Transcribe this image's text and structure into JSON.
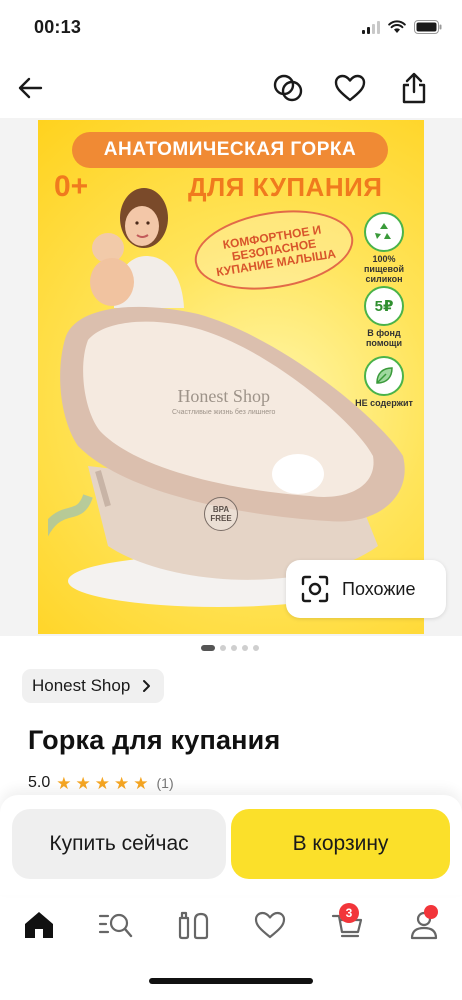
{
  "status_bar": {
    "time": "00:13"
  },
  "product_image": {
    "promo_title": "АНАТОМИЧЕСКАЯ ГОРКА",
    "promo_age": "0+",
    "promo_subtitle": "ДЛЯ КУПАНИЯ",
    "promo_oval_text": "КОМФОРТНОЕ И БЕЗОПАСНОЕ КУПАНИЕ МАЛЫША",
    "badge_silicone": "100% пищевой силикон",
    "badge_donation_value": "5₽",
    "badge_donation": "В фонд помощи",
    "badge_nontoxic": "НЕ содержит",
    "watermark_name": "Honest Shop",
    "watermark_tagline": "Счастливые жизнь без лишнего",
    "bpa_label": "BPA FREE",
    "similar_label": "Похожие",
    "pager_count": 5,
    "pager_active": 1
  },
  "shop": {
    "name": "Honest Shop"
  },
  "product": {
    "title": "Горка для купания",
    "rating": "5.0",
    "stars": 5,
    "reviews_count": "(1)"
  },
  "actions": {
    "buy_now_label": "Купить сейчас",
    "add_to_cart_label": "В корзину"
  },
  "tab_bar": {
    "items": [
      {
        "icon": "home-icon"
      },
      {
        "icon": "catalog-search-icon"
      },
      {
        "icon": "products-icon"
      },
      {
        "icon": "favorites-icon"
      },
      {
        "icon": "cart-icon",
        "badge": "3"
      },
      {
        "icon": "profile-icon",
        "dot": true
      }
    ]
  },
  "colors": {
    "accent_yellow": "#fbe02a",
    "star": "#f5a623",
    "badge_red": "#f2353a"
  }
}
